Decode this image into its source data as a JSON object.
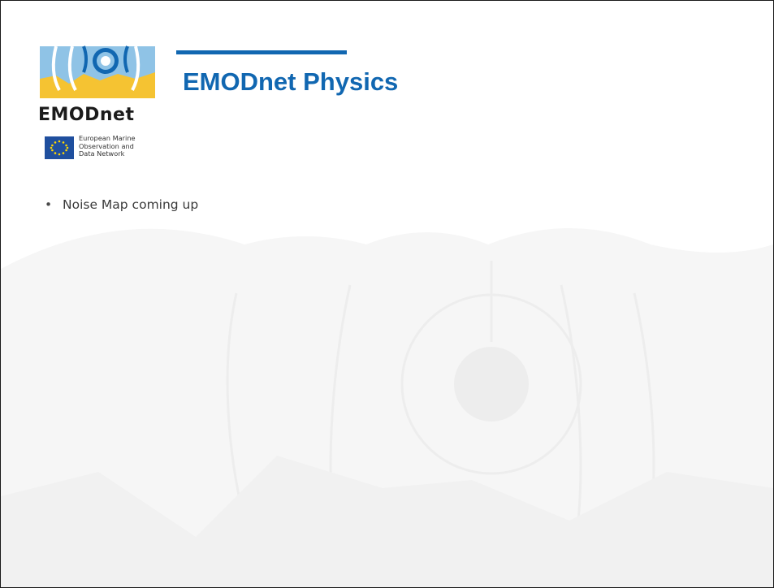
{
  "slide": {
    "title": "EMODnet Physics",
    "bullets": [
      "Noise Map coming up"
    ]
  },
  "logo": {
    "name": "EMODnet",
    "subtitle": [
      "European Marine",
      "Observation and",
      "Data Network"
    ]
  },
  "colors": {
    "title": "#1167b1",
    "logo_blue": "#1167b1",
    "logo_light_blue": "#8fc3e6",
    "logo_yellow": "#f5c332",
    "eu_blue": "#1f4f9e",
    "eu_stars": "#ffd700"
  }
}
